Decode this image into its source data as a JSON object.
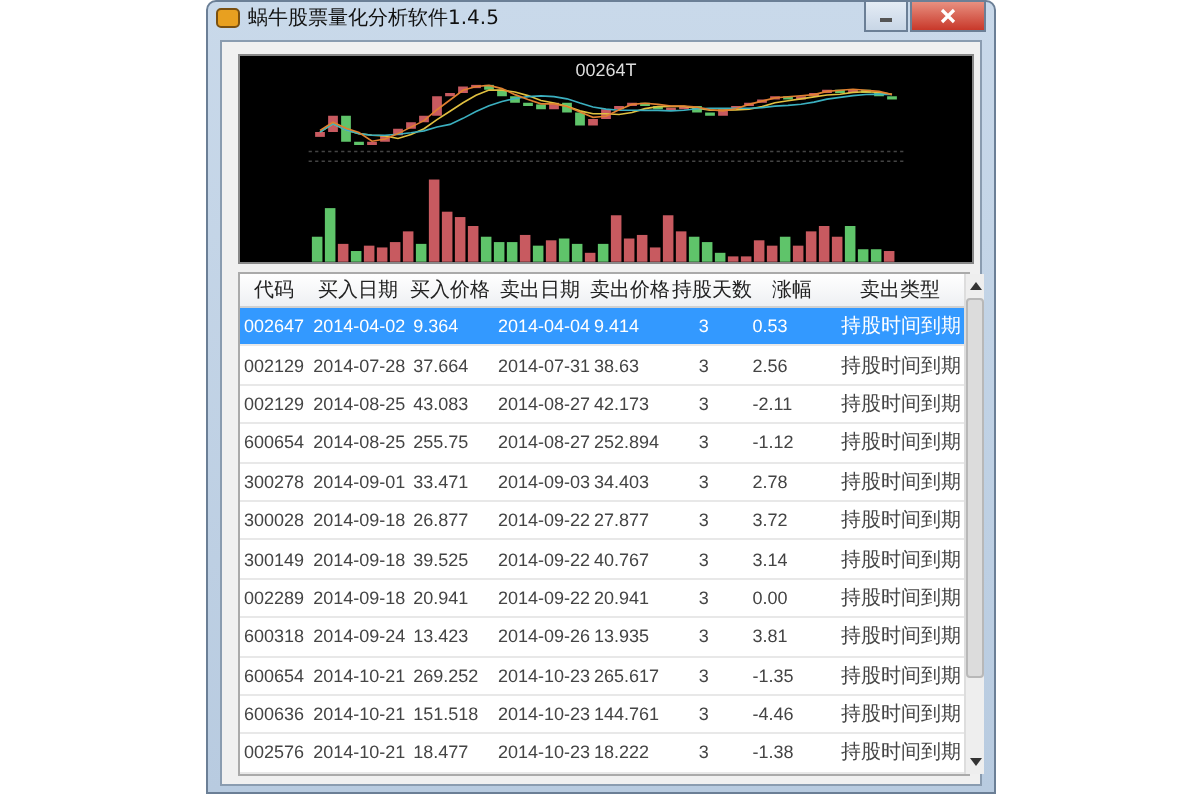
{
  "window": {
    "title": "蜗牛股票量化分析软件1.4.5"
  },
  "chart": {
    "title": "00264T"
  },
  "table": {
    "columns": [
      "代码",
      "买入日期",
      "买入价格",
      "卖出日期",
      "卖出价格",
      "持股天数",
      "涨幅",
      "卖出类型"
    ],
    "rows": [
      {
        "selected": true,
        "cells": [
          "002647",
          "2014-04-02",
          "9.364",
          "2014-04-04",
          "9.414",
          "3",
          "0.53",
          "持股时间到期"
        ]
      },
      {
        "selected": false,
        "cells": [
          "002129",
          "2014-07-28",
          "37.664",
          "2014-07-31",
          "38.63",
          "3",
          "2.56",
          "持股时间到期"
        ]
      },
      {
        "selected": false,
        "cells": [
          "002129",
          "2014-08-25",
          "43.083",
          "2014-08-27",
          "42.173",
          "3",
          "-2.11",
          "持股时间到期"
        ]
      },
      {
        "selected": false,
        "cells": [
          "600654",
          "2014-08-25",
          "255.75",
          "2014-08-27",
          "252.894",
          "3",
          "-1.12",
          "持股时间到期"
        ]
      },
      {
        "selected": false,
        "cells": [
          "300278",
          "2014-09-01",
          "33.471",
          "2014-09-03",
          "34.403",
          "3",
          "2.78",
          "持股时间到期"
        ]
      },
      {
        "selected": false,
        "cells": [
          "300028",
          "2014-09-18",
          "26.877",
          "2014-09-22",
          "27.877",
          "3",
          "3.72",
          "持股时间到期"
        ]
      },
      {
        "selected": false,
        "cells": [
          "300149",
          "2014-09-18",
          "39.525",
          "2014-09-22",
          "40.767",
          "3",
          "3.14",
          "持股时间到期"
        ]
      },
      {
        "selected": false,
        "cells": [
          "002289",
          "2014-09-18",
          "20.941",
          "2014-09-22",
          "20.941",
          "3",
          "0.00",
          "持股时间到期"
        ]
      },
      {
        "selected": false,
        "cells": [
          "600318",
          "2014-09-24",
          "13.423",
          "2014-09-26",
          "13.935",
          "3",
          "3.81",
          "持股时间到期"
        ]
      },
      {
        "selected": false,
        "cells": [
          "600654",
          "2014-10-21",
          "269.252",
          "2014-10-23",
          "265.617",
          "3",
          "-1.35",
          "持股时间到期"
        ]
      },
      {
        "selected": false,
        "cells": [
          "600636",
          "2014-10-21",
          "151.518",
          "2014-10-23",
          "144.761",
          "3",
          "-4.46",
          "持股时间到期"
        ]
      },
      {
        "selected": false,
        "cells": [
          "002576",
          "2014-10-21",
          "18.477",
          "2014-10-23",
          "18.222",
          "3",
          "-1.38",
          "持股时间到期"
        ]
      }
    ]
  }
}
